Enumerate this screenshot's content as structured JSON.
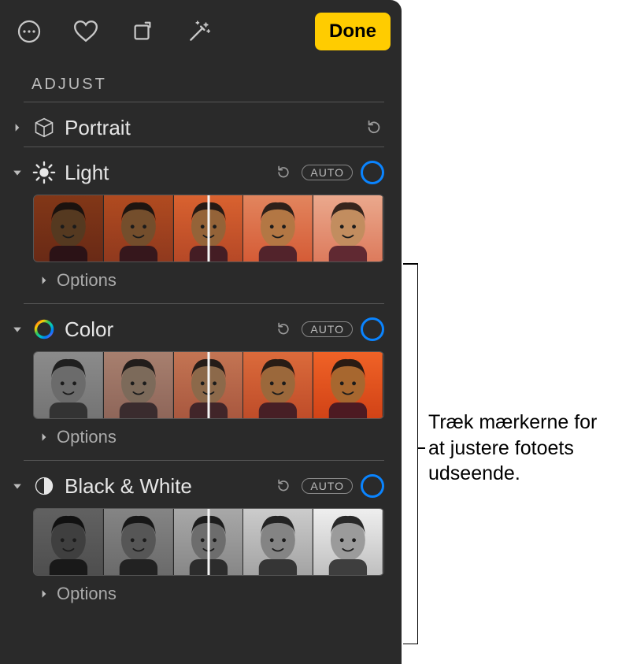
{
  "toolbar": {
    "done_label": "Done"
  },
  "header": {
    "title": "ADJUST"
  },
  "adjustments": {
    "portrait": {
      "label": "Portrait"
    },
    "light": {
      "label": "Light",
      "auto": "AUTO",
      "options": "Options"
    },
    "color": {
      "label": "Color",
      "auto": "AUTO",
      "options": "Options"
    },
    "bw": {
      "label": "Black & White",
      "auto": "AUTO",
      "options": "Options"
    }
  },
  "callout": {
    "text": "Træk mærkerne for at justere fotoets udseende."
  },
  "thumbs": {
    "light_levels": [
      0.55,
      0.75,
      0.95,
      1.15,
      1.35
    ],
    "color_sat": [
      0.0,
      0.35,
      0.7,
      1.0,
      1.25
    ],
    "bw_levels": [
      0.55,
      0.75,
      0.95,
      1.15,
      1.35
    ]
  }
}
